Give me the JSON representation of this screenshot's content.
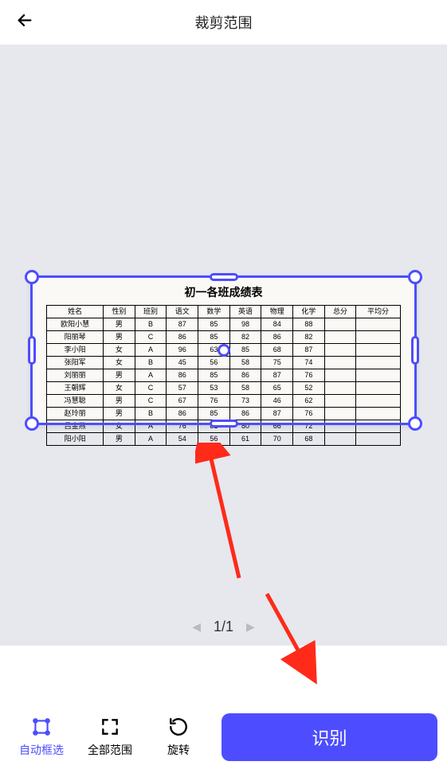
{
  "header": {
    "title": "裁剪范围"
  },
  "pager": {
    "current": "1",
    "total": "1",
    "display": "1/1"
  },
  "toolbar": {
    "auto_crop": "自动框选",
    "full_range": "全部范围",
    "rotate": "旋转",
    "recognize": "识别"
  },
  "document": {
    "title": "初一各班成绩表",
    "headers": [
      "姓名",
      "性别",
      "班别",
      "语文",
      "数学",
      "英语",
      "物理",
      "化学",
      "总分",
      "平均分"
    ],
    "rows": [
      [
        "欧阳小慧",
        "男",
        "B",
        "87",
        "85",
        "98",
        "84",
        "88",
        "",
        ""
      ],
      [
        "阳丽琴",
        "男",
        "C",
        "86",
        "85",
        "82",
        "86",
        "82",
        "",
        ""
      ],
      [
        "李小阳",
        "女",
        "A",
        "96",
        "63",
        "85",
        "68",
        "87",
        "",
        ""
      ],
      [
        "张阳军",
        "女",
        "B",
        "45",
        "56",
        "58",
        "75",
        "74",
        "",
        ""
      ],
      [
        "刘丽丽",
        "男",
        "A",
        "86",
        "85",
        "86",
        "87",
        "76",
        "",
        ""
      ],
      [
        "王朝辉",
        "女",
        "C",
        "57",
        "53",
        "58",
        "65",
        "52",
        "",
        ""
      ],
      [
        "冯慧聪",
        "男",
        "C",
        "67",
        "76",
        "73",
        "46",
        "62",
        "",
        ""
      ],
      [
        "赵玲丽",
        "男",
        "B",
        "86",
        "85",
        "86",
        "87",
        "76",
        "",
        ""
      ],
      [
        "吕金燕",
        "女",
        "A",
        "76",
        "81",
        "80",
        "66",
        "72",
        "",
        ""
      ],
      [
        "阳小阳",
        "男",
        "A",
        "54",
        "56",
        "61",
        "70",
        "68",
        "",
        ""
      ]
    ]
  },
  "colors": {
    "accent": "#4d4dff",
    "canvas_bg": "#e6e8ee",
    "annotation": "#ff2a1a"
  }
}
